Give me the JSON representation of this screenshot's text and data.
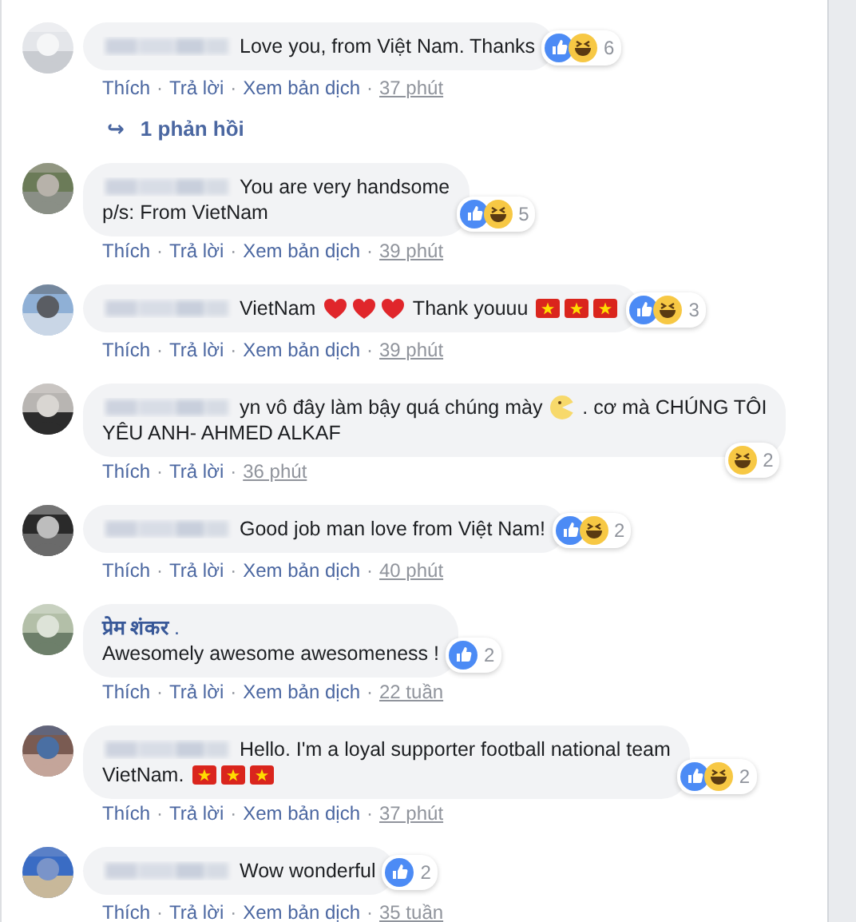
{
  "comments": [
    {
      "author": {
        "blurred": true
      },
      "segments": [
        {
          "kind": "text",
          "text": "Love you, from Việt Nam. Thanks"
        }
      ],
      "reactions": {
        "icons": [
          {
            "kind": "like"
          },
          {
            "kind": "haha"
          }
        ],
        "count": "6"
      },
      "actions": [
        {
          "kind": "link",
          "text": "Thích"
        },
        {
          "kind": "sep",
          "text": "·"
        },
        {
          "kind": "link",
          "text": "Trả lời"
        },
        {
          "kind": "sep",
          "text": "·"
        },
        {
          "kind": "link",
          "text": "Xem bản dịch"
        },
        {
          "kind": "sep",
          "text": "·"
        },
        {
          "kind": "time",
          "text": "37 phút"
        }
      ],
      "replies_link": {
        "arrow": "↪",
        "text": "1 phản hồi"
      }
    },
    {
      "author": {
        "blurred": true
      },
      "segments": [
        {
          "kind": "text",
          "text": "You are very handsome"
        },
        {
          "kind": "break"
        },
        {
          "kind": "text",
          "text": "p/s: From VietNam"
        }
      ],
      "reactions": {
        "icons": [
          {
            "kind": "like"
          },
          {
            "kind": "haha"
          }
        ],
        "count": "5"
      },
      "actions": [
        {
          "kind": "link",
          "text": "Thích"
        },
        {
          "kind": "sep",
          "text": "·"
        },
        {
          "kind": "link",
          "text": "Trả lời"
        },
        {
          "kind": "sep",
          "text": "·"
        },
        {
          "kind": "link",
          "text": "Xem bản dịch"
        },
        {
          "kind": "sep",
          "text": "·"
        },
        {
          "kind": "time",
          "text": "39 phút"
        }
      ]
    },
    {
      "author": {
        "blurred": true
      },
      "segments": [
        {
          "kind": "text",
          "text": "VietNam"
        },
        {
          "kind": "heart"
        },
        {
          "kind": "heart"
        },
        {
          "kind": "heart"
        },
        {
          "kind": "text",
          "text": "Thank youuu"
        },
        {
          "kind": "flag"
        },
        {
          "kind": "flag"
        },
        {
          "kind": "flag"
        }
      ],
      "reactions": {
        "icons": [
          {
            "kind": "like"
          },
          {
            "kind": "haha"
          }
        ],
        "count": "3"
      },
      "actions": [
        {
          "kind": "link",
          "text": "Thích"
        },
        {
          "kind": "sep",
          "text": "·"
        },
        {
          "kind": "link",
          "text": "Trả lời"
        },
        {
          "kind": "sep",
          "text": "·"
        },
        {
          "kind": "link",
          "text": "Xem bản dịch"
        },
        {
          "kind": "sep",
          "text": "·"
        },
        {
          "kind": "time",
          "text": "39 phút"
        }
      ]
    },
    {
      "author": {
        "blurred": true
      },
      "segments": [
        {
          "kind": "text",
          "text": "yn vô đây làm bậy quá chúng mày"
        },
        {
          "kind": "face"
        },
        {
          "kind": "text",
          "text": ". cơ mà CHÚNG TÔI"
        },
        {
          "kind": "break"
        },
        {
          "kind": "text",
          "text": "YÊU ANH- AHMED ALKAF"
        }
      ],
      "reactions": {
        "icons": [
          {
            "kind": "haha"
          }
        ],
        "count": "2"
      },
      "actions": [
        {
          "kind": "link",
          "text": "Thích"
        },
        {
          "kind": "sep",
          "text": "·"
        },
        {
          "kind": "link",
          "text": "Trả lời"
        },
        {
          "kind": "sep",
          "text": "·"
        },
        {
          "kind": "time",
          "text": "36 phút"
        }
      ]
    },
    {
      "author": {
        "blurred": true
      },
      "segments": [
        {
          "kind": "text",
          "text": "Good job man love from Việt Nam!"
        }
      ],
      "reactions": {
        "icons": [
          {
            "kind": "like"
          },
          {
            "kind": "haha"
          }
        ],
        "count": "2"
      },
      "actions": [
        {
          "kind": "link",
          "text": "Thích"
        },
        {
          "kind": "sep",
          "text": "·"
        },
        {
          "kind": "link",
          "text": "Trả lời"
        },
        {
          "kind": "sep",
          "text": "·"
        },
        {
          "kind": "link",
          "text": "Xem bản dịch"
        },
        {
          "kind": "sep",
          "text": "·"
        },
        {
          "kind": "time",
          "text": "40 phút"
        }
      ]
    },
    {
      "author": {
        "blurred": false,
        "name": "**प्रेम शंकर** ."
      },
      "segments": [
        {
          "kind": "text",
          "text": "Awesomely awesome awesomeness !"
        }
      ],
      "reactions": {
        "icons": [
          {
            "kind": "like"
          }
        ],
        "count": "2"
      },
      "actions": [
        {
          "kind": "link",
          "text": "Thích"
        },
        {
          "kind": "sep",
          "text": "·"
        },
        {
          "kind": "link",
          "text": "Trả lời"
        },
        {
          "kind": "sep",
          "text": "·"
        },
        {
          "kind": "link",
          "text": "Xem bản dịch"
        },
        {
          "kind": "sep",
          "text": "·"
        },
        {
          "kind": "time",
          "text": "22 tuần"
        }
      ]
    },
    {
      "author": {
        "blurred": true
      },
      "segments": [
        {
          "kind": "text",
          "text": "Hello. I'm a loyal supporter football national team"
        },
        {
          "kind": "break"
        },
        {
          "kind": "text",
          "text": "VietNam."
        },
        {
          "kind": "flag"
        },
        {
          "kind": "flag"
        },
        {
          "kind": "flag"
        }
      ],
      "reactions": {
        "icons": [
          {
            "kind": "like"
          },
          {
            "kind": "haha"
          }
        ],
        "count": "2"
      },
      "actions": [
        {
          "kind": "link",
          "text": "Thích"
        },
        {
          "kind": "sep",
          "text": "·"
        },
        {
          "kind": "link",
          "text": "Trả lời"
        },
        {
          "kind": "sep",
          "text": "·"
        },
        {
          "kind": "link",
          "text": "Xem bản dịch"
        },
        {
          "kind": "sep",
          "text": "·"
        },
        {
          "kind": "time",
          "text": "37 phút"
        }
      ]
    },
    {
      "author": {
        "blurred": true
      },
      "segments": [
        {
          "kind": "text",
          "text": "Wow wonderful"
        }
      ],
      "reactions": {
        "icons": [
          {
            "kind": "like"
          }
        ],
        "count": "2"
      },
      "actions": [
        {
          "kind": "link",
          "text": "Thích"
        },
        {
          "kind": "sep",
          "text": "·"
        },
        {
          "kind": "link",
          "text": "Trả lời"
        },
        {
          "kind": "sep",
          "text": "·"
        },
        {
          "kind": "link",
          "text": "Xem bản dịch"
        },
        {
          "kind": "sep",
          "text": "·"
        },
        {
          "kind": "time",
          "text": "35 tuần"
        }
      ]
    }
  ]
}
